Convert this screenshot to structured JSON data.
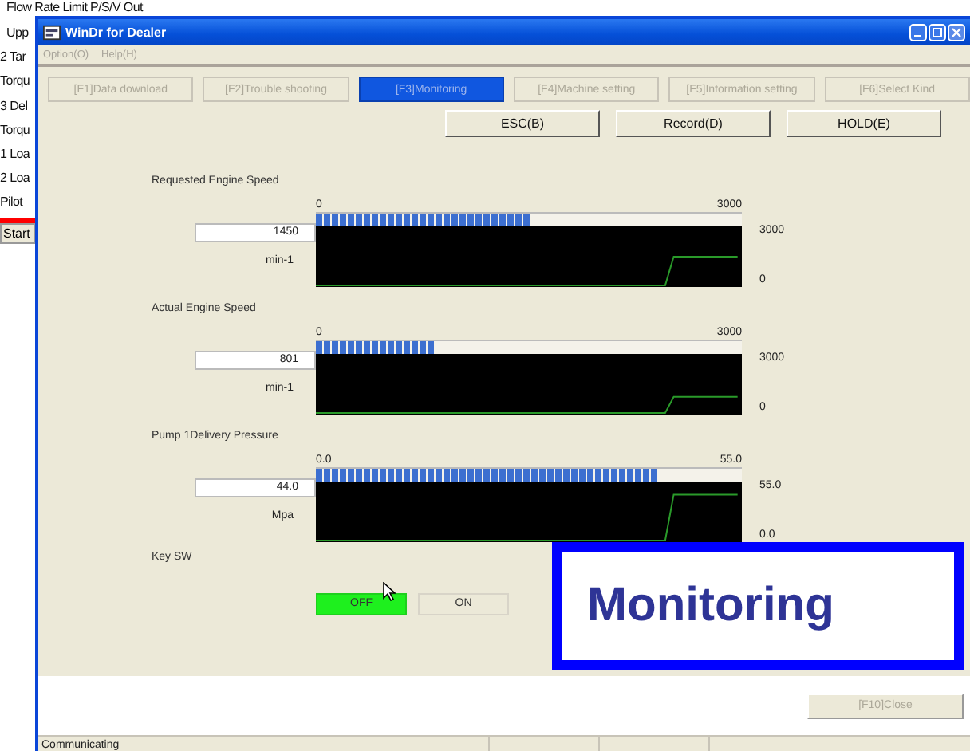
{
  "background_window": {
    "lines": [
      "Flow Rate Limit P/S/V Out",
      "Upp",
      "2 Tar",
      "Torqu",
      "3 Del",
      "Torqu",
      "1 Loa",
      "2 Loa",
      "Pilot"
    ],
    "button": "Start"
  },
  "window": {
    "title": "WinDr for Dealer"
  },
  "menu": [
    {
      "label": "Option(O)",
      "disabled": true
    },
    {
      "label": "Help(H)",
      "disabled": true
    }
  ],
  "tabs": [
    {
      "label": "[F1]Data download",
      "selected": false,
      "disabled": true
    },
    {
      "label": "[F2]Trouble shooting",
      "selected": false,
      "disabled": true
    },
    {
      "label": "[F3]Monitoring",
      "selected": true,
      "disabled": false
    },
    {
      "label": "[F4]Machine setting",
      "selected": false,
      "disabled": true
    },
    {
      "label": "[F5]Information setting",
      "selected": false,
      "disabled": true
    },
    {
      "label": "[F6]Select Kind",
      "selected": false,
      "disabled": true
    }
  ],
  "action_buttons": [
    "ESC(B)",
    "Record(D)",
    "HOLD(E)"
  ],
  "gauges": [
    {
      "title": "Requested Engine Speed",
      "value": "1450",
      "unit": "min-1",
      "scale_min": "0",
      "scale_max": "3000",
      "axis_max": "3000",
      "axis_min": "0",
      "level": 0.5
    },
    {
      "title": "Actual Engine Speed",
      "value": "801",
      "unit": "min-1",
      "scale_min": "0",
      "scale_max": "3000",
      "axis_max": "3000",
      "axis_min": "0",
      "level": 0.28
    },
    {
      "title": "Pump 1Delivery Pressure",
      "value": "44.0",
      "unit": "Mpa",
      "scale_min": "0.0",
      "scale_max": "55.0",
      "axis_max": "55.0",
      "axis_min": "0.0",
      "level": 0.8
    }
  ],
  "key_switch": {
    "title": "Key SW",
    "options": [
      {
        "label": "OFF",
        "selected": true
      },
      {
        "label": "ON",
        "selected": false
      }
    ]
  },
  "overlay_label": "Monitoring",
  "close_button": {
    "label": "[F10]Close",
    "disabled": true
  },
  "status_bar": [
    "Communicating"
  ]
}
